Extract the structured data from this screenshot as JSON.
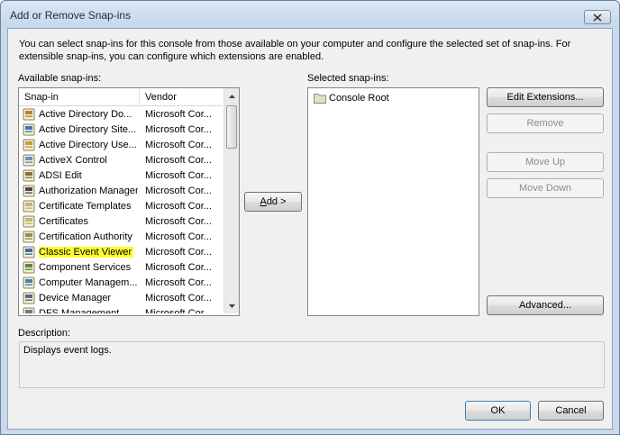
{
  "window": {
    "title": "Add or Remove Snap-ins"
  },
  "intro": "You can select snap-ins for this console from those available on your computer and configure the selected set of snap-ins. For extensible snap-ins, you can configure which extensions are enabled.",
  "available": {
    "label": "Available snap-ins:",
    "columns": {
      "name": "Snap-in",
      "vendor": "Vendor"
    },
    "items": [
      {
        "name": "Active Directory Do...",
        "vendor": "Microsoft Cor...",
        "icon": "directory-icon"
      },
      {
        "name": "Active Directory Site...",
        "vendor": "Microsoft Cor...",
        "icon": "directory-sites-icon"
      },
      {
        "name": "Active Directory Use...",
        "vendor": "Microsoft Cor...",
        "icon": "directory-users-icon"
      },
      {
        "name": "ActiveX Control",
        "vendor": "Microsoft Cor...",
        "icon": "activex-icon"
      },
      {
        "name": "ADSI Edit",
        "vendor": "Microsoft Cor...",
        "icon": "adsi-edit-icon"
      },
      {
        "name": "Authorization Manager",
        "vendor": "Microsoft Cor...",
        "icon": "authorization-icon"
      },
      {
        "name": "Certificate Templates",
        "vendor": "Microsoft Cor...",
        "icon": "certificate-templates-icon"
      },
      {
        "name": "Certificates",
        "vendor": "Microsoft Cor...",
        "icon": "certificates-icon"
      },
      {
        "name": "Certification Authority",
        "vendor": "Microsoft Cor...",
        "icon": "certification-authority-icon"
      },
      {
        "name": "Classic Event Viewer",
        "vendor": "Microsoft Cor...",
        "icon": "event-viewer-icon"
      },
      {
        "name": "Component Services",
        "vendor": "Microsoft Cor...",
        "icon": "component-services-icon"
      },
      {
        "name": "Computer Managem...",
        "vendor": "Microsoft Cor...",
        "icon": "computer-management-icon"
      },
      {
        "name": "Device Manager",
        "vendor": "Microsoft Cor...",
        "icon": "device-manager-icon"
      },
      {
        "name": "DFS Management",
        "vendor": "Microsoft Cor...",
        "icon": "dfs-icon"
      }
    ],
    "highlighted_index": 9
  },
  "buttons": {
    "add": "Add >",
    "edit_extensions": "Edit Extensions...",
    "remove": "Remove",
    "move_up": "Move Up",
    "move_down": "Move Down",
    "advanced": "Advanced...",
    "ok": "OK",
    "cancel": "Cancel"
  },
  "selected": {
    "label": "Selected snap-ins:",
    "items": [
      {
        "name": "Console Root",
        "icon": "folder-icon"
      }
    ]
  },
  "description": {
    "label": "Description:",
    "text": "Displays event logs."
  },
  "colors": {
    "highlight": "#ffff2e",
    "title_bar": "#c5d7ec",
    "dialog_bg": "#f0f0f0"
  }
}
